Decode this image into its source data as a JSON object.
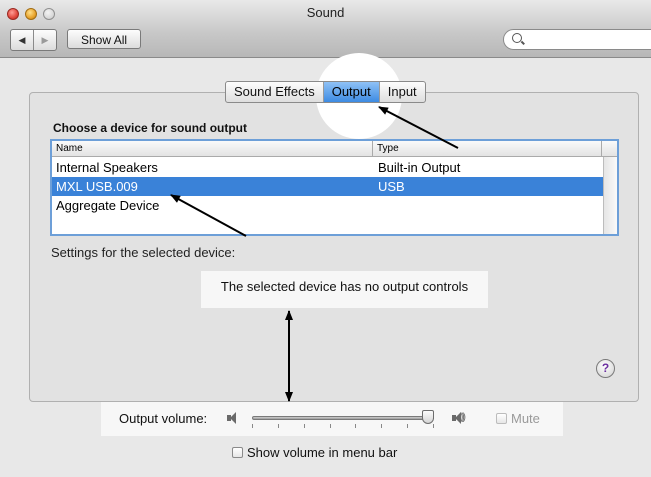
{
  "window": {
    "title": "Sound"
  },
  "toolbar": {
    "back_icon": "back-icon",
    "forward_icon": "forward-icon",
    "show_all_label": "Show All",
    "search_placeholder": ""
  },
  "tabs": [
    {
      "label": "Sound Effects",
      "selected": false
    },
    {
      "label": "Output",
      "selected": true
    },
    {
      "label": "Input",
      "selected": false
    }
  ],
  "output": {
    "heading": "Choose a device for sound output",
    "columns": {
      "name": "Name",
      "type": "Type"
    },
    "devices": [
      {
        "name": "Internal Speakers",
        "type": "Built-in Output",
        "selected": false
      },
      {
        "name": "MXL USB.009",
        "type": "USB",
        "selected": true
      },
      {
        "name": "Aggregate Device",
        "type": "",
        "selected": false
      }
    ],
    "settings_label": "Settings for the selected device:",
    "no_controls_message": "The selected device has no output controls"
  },
  "volume": {
    "label": "Output volume:",
    "level": 1.0,
    "mute_label": "Mute",
    "muted": false
  },
  "menu_bar_option": {
    "label": "Show volume in menu bar",
    "checked": false
  },
  "help_label": "?",
  "colors": {
    "selection": "#3a82d8",
    "tab_selected": "#3d8be3"
  }
}
